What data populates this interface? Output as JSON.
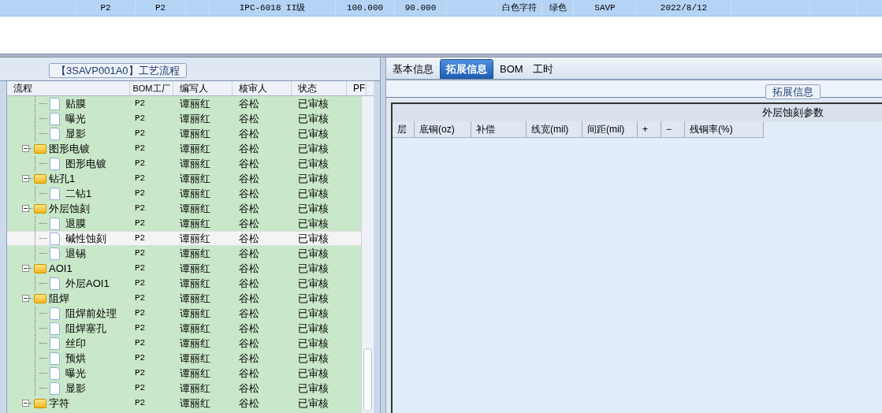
{
  "top_grid": {
    "row": [
      "P2",
      "P2",
      "IPC-6018 II级",
      "100.000",
      "90.000",
      "白色字符",
      "绿色",
      "SAVP",
      "2022/8/12"
    ]
  },
  "process_panel": {
    "title": "【3SAVP001A0】工艺流程",
    "columns": [
      "流程",
      "BOM工厂",
      "编写人",
      "核审人",
      "状态",
      "PF"
    ],
    "tree": [
      {
        "children": [
          {
            "label": "贴膜",
            "bom": "P2",
            "author": "谭丽红",
            "reviewer": "谷松",
            "status": "已审核",
            "selected": false
          },
          {
            "label": "曝光",
            "bom": "P2",
            "author": "谭丽红",
            "reviewer": "谷松",
            "status": "已审核",
            "selected": false
          },
          {
            "label": "显影",
            "bom": "P2",
            "author": "谭丽红",
            "reviewer": "谷松",
            "status": "已审核",
            "selected": false
          }
        ]
      },
      {
        "label": "图形电镀",
        "bom": "P2",
        "author": "谭丽红",
        "reviewer": "谷松",
        "status": "已审核",
        "selected": false,
        "expanded": true,
        "children": [
          {
            "label": "图形电镀",
            "bom": "P2",
            "author": "谭丽红",
            "reviewer": "谷松",
            "status": "已审核",
            "selected": false
          }
        ]
      },
      {
        "label": "钻孔1",
        "bom": "P2",
        "author": "谭丽红",
        "reviewer": "谷松",
        "status": "已审核",
        "selected": false,
        "expanded": true,
        "children": [
          {
            "label": "二钻1",
            "bom": "P2",
            "author": "谭丽红",
            "reviewer": "谷松",
            "status": "已审核",
            "selected": false
          }
        ]
      },
      {
        "label": "外层蚀刻",
        "bom": "P2",
        "author": "谭丽红",
        "reviewer": "谷松",
        "status": "已审核",
        "selected": false,
        "expanded": true,
        "children": [
          {
            "label": "退膜",
            "bom": "P2",
            "author": "谭丽红",
            "reviewer": "谷松",
            "status": "已审核",
            "selected": false
          },
          {
            "label": "碱性蚀刻",
            "bom": "P2",
            "author": "谭丽红",
            "reviewer": "谷松",
            "status": "已审核",
            "selected": true
          },
          {
            "label": "退锡",
            "bom": "P2",
            "author": "谭丽红",
            "reviewer": "谷松",
            "status": "已审核",
            "selected": false
          }
        ]
      },
      {
        "label": "AOI1",
        "bom": "P2",
        "author": "谭丽红",
        "reviewer": "谷松",
        "status": "已审核",
        "selected": false,
        "expanded": true,
        "children": [
          {
            "label": "外层AOI1",
            "bom": "P2",
            "author": "谭丽红",
            "reviewer": "谷松",
            "status": "已审核",
            "selected": false
          }
        ]
      },
      {
        "label": "阻焊",
        "bom": "P2",
        "author": "谭丽红",
        "reviewer": "谷松",
        "status": "已审核",
        "selected": false,
        "expanded": true,
        "children": [
          {
            "label": "阻焊前处理",
            "bom": "P2",
            "author": "谭丽红",
            "reviewer": "谷松",
            "status": "已审核",
            "selected": false
          },
          {
            "label": "阻焊塞孔",
            "bom": "P2",
            "author": "谭丽红",
            "reviewer": "谷松",
            "status": "已审核",
            "selected": false
          },
          {
            "label": "丝印",
            "bom": "P2",
            "author": "谭丽红",
            "reviewer": "谷松",
            "status": "已审核",
            "selected": false
          },
          {
            "label": "预烘",
            "bom": "P2",
            "author": "谭丽红",
            "reviewer": "谷松",
            "status": "已审核",
            "selected": false
          },
          {
            "label": "曝光",
            "bom": "P2",
            "author": "谭丽红",
            "reviewer": "谷松",
            "status": "已审核",
            "selected": false
          },
          {
            "label": "显影",
            "bom": "P2",
            "author": "谭丽红",
            "reviewer": "谷松",
            "status": "已审核",
            "selected": false
          }
        ]
      },
      {
        "label": "字符",
        "bom": "P2",
        "author": "谭丽红",
        "reviewer": "谷松",
        "status": "已审核",
        "selected": false,
        "expanded": true
      }
    ]
  },
  "detail_panel": {
    "tabs": [
      {
        "label": "基本信息",
        "selected": false
      },
      {
        "label": "拓展信息",
        "selected": true
      },
      {
        "label": "BOM",
        "selected": false
      },
      {
        "label": "工时",
        "selected": false
      }
    ],
    "group_title": "拓展信息",
    "table_title": "外层蚀刻参数",
    "columns": [
      "层",
      "底铜(oz)",
      "补偿",
      "线宽(mil)",
      "间距(mil)",
      "+",
      "−",
      "残铜率(%)"
    ]
  }
}
